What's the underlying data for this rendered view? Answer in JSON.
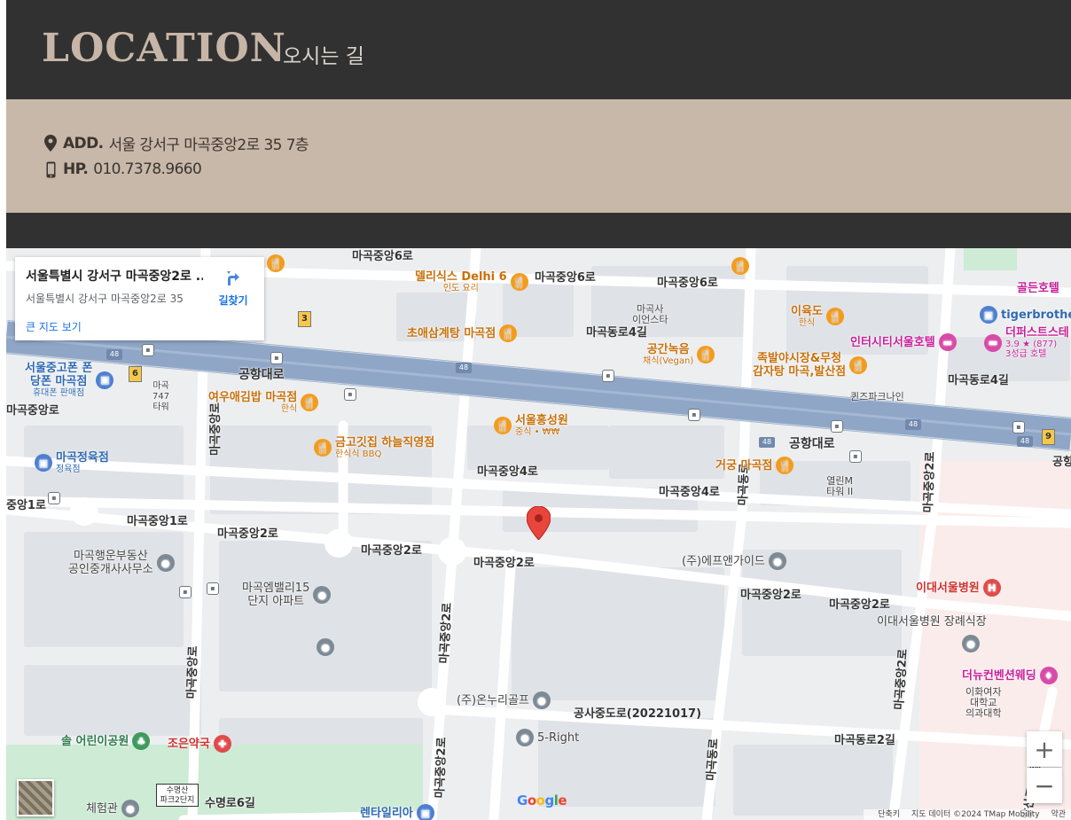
{
  "header": {
    "title": "LOCATION",
    "subtitle": "오시는 길"
  },
  "info": {
    "address_label": "ADD.",
    "address_value": "서울 강서구 마곡중앙2로 35 7층",
    "phone_label": "HP.",
    "phone_value": "010.7378.9660"
  },
  "map": {
    "card": {
      "title": "서울특별시 강서구 마곡중앙2로 ...",
      "address": "서울특별시 강서구 마곡중앙2로 35",
      "directions": "길찾기",
      "larger_map": "큰 지도 보기"
    },
    "streets": [
      "마곡중앙6로",
      "마곡중앙6로",
      "마곡중앙6로",
      "마곡동로4길",
      "공항대로",
      "공항대로",
      "마곡중앙로",
      "마곡중앙4로",
      "마곡중앙4로",
      "마곡중앙1로",
      "마곡중앙2로",
      "마곡중앙2로",
      "마곡중앙2로",
      "마곡중앙2로",
      "마곡중앙2로",
      "공사중도로(20221017)",
      "마곡동로2길",
      "수명로6길",
      "마곡동로4길",
      "중앙1로",
      "마곡중앙로",
      "마곡동로",
      "마곡중앙2로",
      "마곡중앙2로",
      "마곡중앙로",
      "마곡동로",
      "마곡중앙2로",
      "마곡중앙2로",
      "발산로36길",
      "공항대로"
    ],
    "pois": {
      "delhi6": "델리식스 Delhi 6",
      "delhi6_sub": "인도 요리",
      "choae": "초애삼계탕 마곡점",
      "magoksa": "마곡사",
      "magoksa2": "이언스타",
      "gonggan": "공간녹음",
      "gonggan_sub": "채식(Vegan)",
      "iyukdo": "이육도",
      "iyukdo_sub": "한식",
      "intercity": "인터시티서울호텔",
      "tiger": "tigerbrothers",
      "golden": "골든호텔",
      "fourpoints": "더퍼스트스테",
      "fourpoints_rating": "3.9 ★ (877)",
      "fourpoints_sub": "3성급 호텔",
      "jokbal": "족발야시장&무청",
      "jokbal2": "감자탕 마곡,발산점",
      "queens": "퀸즈파크나인",
      "seoulcorp": "서울중고폰 폰",
      "seoulcorp2": "당폰 마곡점",
      "seoulcorp_sub": "휴대폰 판매점",
      "magok747": "마곡",
      "magok747b": "747",
      "magok747c": "타워",
      "yeou": "여우애김밥 마곡점",
      "yeou_sub": "한식",
      "seoulhong": "서울홍성원",
      "seoulhong_sub": "중식 • ₩₩",
      "geumgo": "금고깃집 하늘직영점",
      "geumgo_sub": "한식식 BBQ",
      "magokmeat": "마곡정육점",
      "magokmeat_sub": "정육점",
      "geogung": "거궁 마곡점",
      "yeolrim": "열린M",
      "yeolrim2": "타워 II",
      "haengun": "마곡행운부동산",
      "haengun2": "공인중개사사무소",
      "emvalley": "마곡엠밸리15",
      "emvalley2": "단지 아파트",
      "fnguide": "(주)에프앤가이드",
      "ewha": "이대서울병원",
      "ewha_funeral": "이대서울병원 장례식장",
      "convention": "더뉴컨벤션웨딩",
      "ewhamed": "이화여자",
      "ewhamed2": "대학교",
      "ewhamed3": "의과대학",
      "onnuri": "(주)온누리골프",
      "fiveright": "5-Right",
      "sol": "솔 어린이공원",
      "joeun": "조은약국",
      "rental": "렌타일리아",
      "experience": "체험관",
      "road_sign1": "수명산",
      "road_sign2": "파크2단지"
    },
    "route_numbers": [
      "3",
      "6",
      "9",
      "48",
      "48",
      "48",
      "48",
      "48"
    ],
    "google_logo": "Google",
    "footer": [
      "단축키",
      "지도 데이터 ©2024 TMap Mobility",
      "약관"
    ],
    "zoom_in": "+",
    "zoom_out": "−"
  }
}
